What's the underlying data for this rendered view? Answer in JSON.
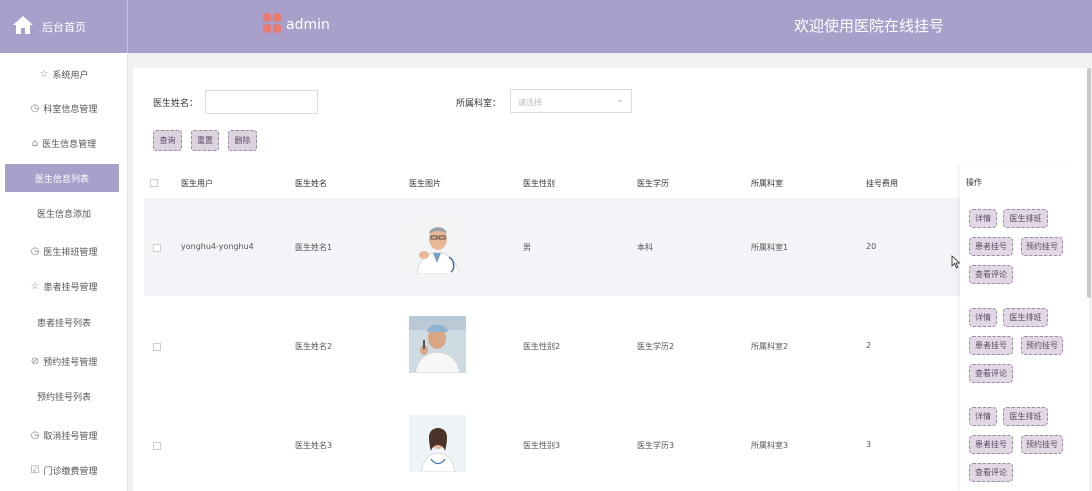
{
  "header": {
    "home_label": "后台首页",
    "brand": "admin",
    "welcome": "欢迎使用医院在线挂号",
    "bg_color": "#a99fcb"
  },
  "sidebar": {
    "items": [
      {
        "label": "系统用户",
        "icon": "star-icon",
        "glyph": "☆"
      },
      {
        "label": "科室信息管理",
        "icon": "clock-icon",
        "glyph": "◷"
      },
      {
        "label": "医生信息管理",
        "icon": "gift-icon",
        "glyph": "⌂"
      },
      {
        "label": "医生信息列表",
        "icon": "",
        "glyph": ""
      },
      {
        "label": "医生信息添加",
        "icon": "",
        "glyph": ""
      },
      {
        "label": "医生排班管理",
        "icon": "clock-icon",
        "glyph": "◷"
      },
      {
        "label": "患者挂号管理",
        "icon": "star-icon",
        "glyph": "☆"
      },
      {
        "label": "患者挂号列表",
        "icon": "",
        "glyph": ""
      },
      {
        "label": "预约挂号管理",
        "icon": "compass-icon",
        "glyph": "⊘"
      },
      {
        "label": "预约挂号列表",
        "icon": "",
        "glyph": ""
      },
      {
        "label": "取消挂号管理",
        "icon": "clock-icon",
        "glyph": "◷"
      },
      {
        "label": "门诊缴费管理",
        "icon": "checkbox-icon",
        "glyph": "☑"
      }
    ]
  },
  "search": {
    "name_label": "医生姓名：",
    "name_value": "",
    "dept_label": "所属科室：",
    "dept_placeholder": "请选择",
    "query_label": "查询",
    "reset_label": "重置",
    "delete_label": "删除"
  },
  "table": {
    "headers": [
      "医生用户",
      "医生姓名",
      "医生图片",
      "医生性别",
      "医生学历",
      "所属科室",
      "挂号费用",
      "操作"
    ],
    "rows": [
      {
        "user": "yonghu4-yonghu4",
        "name": "医生姓名1",
        "gender": "男",
        "edu": "本科",
        "dept": "所属科室1",
        "fee": "20"
      },
      {
        "user": "",
        "name": "医生姓名2",
        "gender": "医生性别2",
        "edu": "医生学历2",
        "dept": "所属科室2",
        "fee": "2"
      },
      {
        "user": "",
        "name": "医生姓名3",
        "gender": "医生性别3",
        "edu": "医生学历3",
        "dept": "所属科室3",
        "fee": "3"
      }
    ],
    "ops": [
      "详情",
      "医生排班",
      "患者挂号",
      "预约挂号",
      "查看评论"
    ]
  }
}
